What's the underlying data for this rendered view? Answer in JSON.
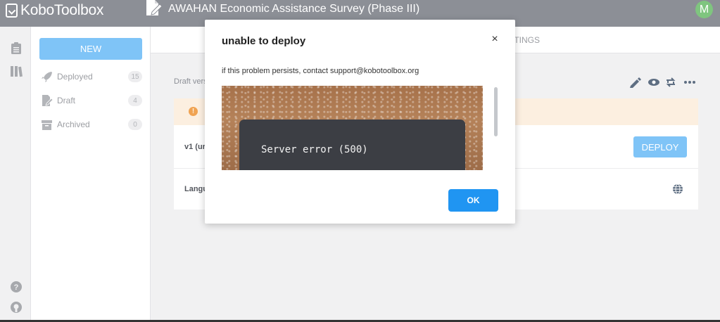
{
  "header": {
    "logo_text": "KoboToolbox",
    "asset_title": "AWAHAN Economic Assistance Survey (Phase III)",
    "avatar_initial": "M"
  },
  "sidebar": {
    "new_label": "NEW",
    "items": [
      {
        "label": "Deployed",
        "count": "15",
        "icon": "rocket-icon"
      },
      {
        "label": "Draft",
        "count": "4",
        "icon": "draft-doc-icon"
      },
      {
        "label": "Archived",
        "count": "0",
        "icon": "archive-icon"
      }
    ]
  },
  "main": {
    "tab_settings": "ETTINGS",
    "draft_label": "Draft vers",
    "row1_label": "v1 (ur",
    "row2_label": "Langu",
    "deploy_label": "DEPLOY"
  },
  "modal": {
    "title": "unable to deploy",
    "close_symbol": "×",
    "message": "if this problem persists, contact support@kobotoolbox.org",
    "image_text": "Server error (500)",
    "ok_label": "OK"
  },
  "colors": {
    "topbar": "#8c8f96",
    "primary_blue": "#2095f2",
    "light_blue": "#7fc4f7",
    "warning_bg": "#fcefe0"
  }
}
